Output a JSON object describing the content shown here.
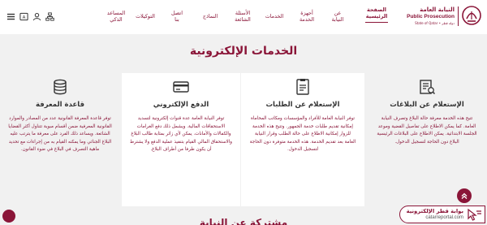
{
  "header": {
    "logo": {
      "arabic": "النيابة العامة",
      "english": "Public Prosecution",
      "sub": "دولة قطر • State of Qatar"
    },
    "nav": [
      {
        "label_line1": "الصفحة",
        "label_line2": "الرئيسية",
        "active": true
      },
      {
        "label_line1": "عن",
        "label_line2": "النيابة",
        "active": false
      },
      {
        "label_line1": "أجهزة",
        "label_line2": "الخدمة",
        "active": false
      },
      {
        "label_line1": "الخدمات",
        "label_line2": "",
        "active": false
      },
      {
        "label_line1": "الأسئلة",
        "label_line2": "الشائعة",
        "active": false
      },
      {
        "label_line1": "النماذج",
        "label_line2": "",
        "active": false
      },
      {
        "label_line1": "اتصل",
        "label_line2": "بنا",
        "active": false
      },
      {
        "label_line1": "التوكيلات",
        "label_line2": "",
        "active": false
      },
      {
        "label_line1": "المساعد",
        "label_line2": "الذكي",
        "active": false
      }
    ],
    "icons": [
      "menu-icon",
      "language-icon",
      "user-icon",
      "sitemap-icon"
    ],
    "accent_color": "#8a1538"
  },
  "banner": {
    "title": "الخدمات الإلكترونية"
  },
  "cards": [
    {
      "icon": "report-icon",
      "title": "الإستعلام عن البلاغات",
      "body": "تتيح هذه الخدمة معرفة حالة البلاغ وتصرف النيابة العامة. كما يمكن الاطلاع على تفاصيل القضية وموعد الجلسة الابتدائية. يمكن الاطلاع على البلاغات الرئيسية البلاغ دون الحاجة لتسجيل الدخول."
    },
    {
      "icon": "requests-icon",
      "title": "الإستعلام عن الطلبات",
      "body": "توفر النيابة العامة للأفراد والمؤسسات ومكاتب المحاماة إمكانية تقديم طلبات خدمة الجمهور. وتتيح هذه الخدمة للزوار إمكانية الاطلاع على حالة الطلب وقرار النيابة العامة بعد تقديم الخدمة. هذه الخدمة متوفرة دون الحاجة لتسجيل الدخول."
    },
    {
      "icon": "payment-icon",
      "title": "الدفع الإلكتروني",
      "body": "توفر النيابة العامة عدة قنوات إلكترونية لتسديد الاستحقاقات المالية. ويشمل ذلك دفع الغرامات والكفالات والأمانات. يمكن لأي زائر بمثابة طالب البلاغ والاستحقاق المالي القيام بتنفيذ عملية الدفع ولا يشترط أن يكون طرفا من أطراف البلاغ."
    },
    {
      "icon": "database-icon",
      "title": "قاعدة المعرفة",
      "body": "توفر قاعدة المعرفة القانونية عدد من المصادر والموارد القانونية المعرفية ضمن أقسام مبوبة تتناول أكثر القضايا الشائعة. ويساعد ذلك الفرد على معرفة ما يترتب عليه البلاغ الجنائي وما يمكنه القيام به من إجراءات مع تحديد ماهية التصرف في البلاغ في ضوء القانون."
    }
  ],
  "bottom": {
    "section_title": "مشتركة عن النيابة",
    "portal_arabic": "بوابة قطر الإلكترونية",
    "portal_english": "catarreportal.com"
  }
}
